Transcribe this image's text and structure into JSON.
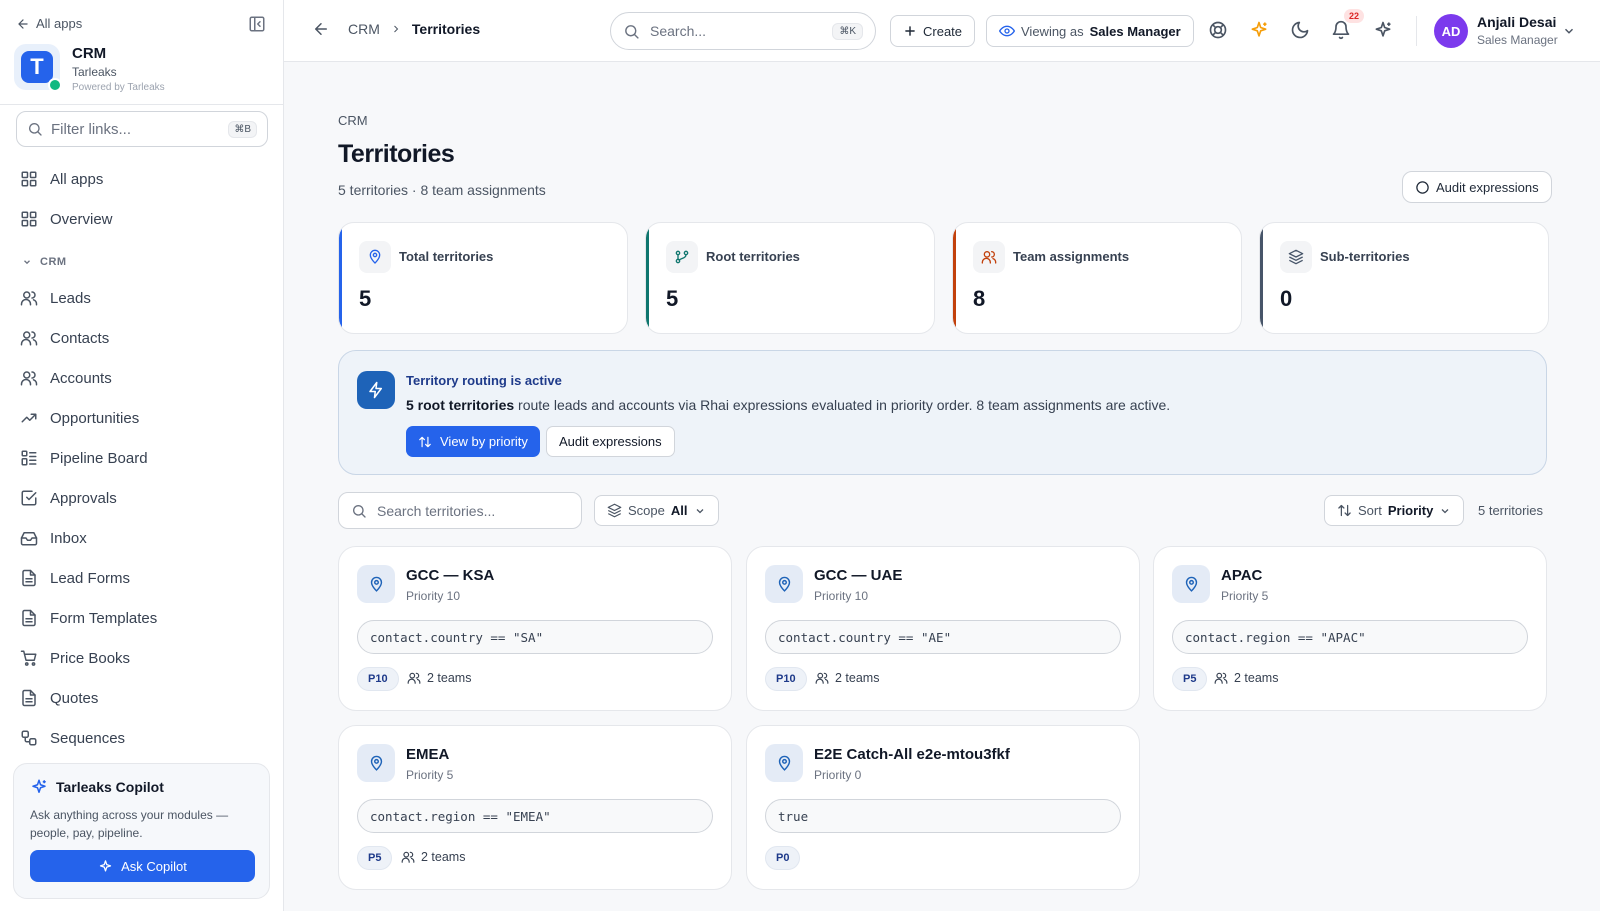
{
  "sidebar": {
    "back_label": "All apps",
    "app_name": "CRM",
    "org_name": "Tarleaks",
    "powered_by": "Powered by Tarleaks",
    "logo_letter": "T",
    "filter_placeholder": "Filter links...",
    "filter_shortcut": "⌘B",
    "top_items": [
      {
        "label": "All apps",
        "icon": "grid-icon"
      },
      {
        "label": "Overview",
        "icon": "grid-icon"
      }
    ],
    "section_label": "CRM",
    "items": [
      {
        "label": "Leads",
        "icon": "users-icon"
      },
      {
        "label": "Contacts",
        "icon": "users-icon"
      },
      {
        "label": "Accounts",
        "icon": "users-icon"
      },
      {
        "label": "Opportunities",
        "icon": "trending-up-icon"
      },
      {
        "label": "Pipeline Board",
        "icon": "kanban-icon"
      },
      {
        "label": "Approvals",
        "icon": "check-square-icon"
      },
      {
        "label": "Inbox",
        "icon": "inbox-icon"
      },
      {
        "label": "Lead Forms",
        "icon": "document-icon"
      },
      {
        "label": "Form Templates",
        "icon": "document-icon"
      },
      {
        "label": "Price Books",
        "icon": "cart-icon"
      },
      {
        "label": "Quotes",
        "icon": "document-icon"
      },
      {
        "label": "Sequences",
        "icon": "workflow-icon"
      }
    ],
    "copilot": {
      "title": "Tarleaks Copilot",
      "description": "Ask anything across your modules — people, pay, pipeline.",
      "button_label": "Ask Copilot"
    }
  },
  "header": {
    "breadcrumb": [
      "CRM",
      "Territories"
    ],
    "search_placeholder": "Search...",
    "search_shortcut": "⌘K",
    "create_label": "Create",
    "viewing_prefix": "Viewing as",
    "viewing_role": "Sales Manager",
    "notification_count": "22",
    "user": {
      "initials": "AD",
      "name": "Anjali Desai",
      "role": "Sales Manager"
    }
  },
  "page": {
    "pre_title": "CRM",
    "title": "Territories",
    "subtitle": "5 territories · 8 team assignments",
    "audit_button": "Audit expressions"
  },
  "stats": [
    {
      "label": "Total territories",
      "value": "5",
      "accent": "#2563eb",
      "icon": "map-pin-icon"
    },
    {
      "label": "Root territories",
      "value": "5",
      "accent": "#0f766e",
      "icon": "git-branch-icon"
    },
    {
      "label": "Team assignments",
      "value": "8",
      "accent": "#c2410c",
      "icon": "users-icon"
    },
    {
      "label": "Sub-territories",
      "value": "0",
      "accent": "#475569",
      "icon": "layers-icon"
    }
  ],
  "routing": {
    "title": "Territory routing is active",
    "desc_bold": "5 root territories",
    "desc_rest": " route leads and accounts via Rhai expressions evaluated in priority order. 8 team assignments are active.",
    "primary_button": "View by priority",
    "secondary_button": "Audit expressions"
  },
  "toolbar": {
    "search_placeholder": "Search territories...",
    "scope_label": "Scope",
    "scope_value": "All",
    "sort_label": "Sort",
    "sort_value": "Priority",
    "count_label": "5 territories"
  },
  "territories": [
    {
      "name": "GCC — KSA",
      "priority": "Priority 10",
      "expression": "contact.country == \"SA\"",
      "badge": "P10",
      "teams": "2 teams"
    },
    {
      "name": "GCC — UAE",
      "priority": "Priority 10",
      "expression": "contact.country == \"AE\"",
      "badge": "P10",
      "teams": "2 teams"
    },
    {
      "name": "APAC",
      "priority": "Priority 5",
      "expression": "contact.region == \"APAC\"",
      "badge": "P5",
      "teams": "2 teams"
    },
    {
      "name": "EMEA",
      "priority": "Priority 5",
      "expression": "contact.region == \"EMEA\"",
      "badge": "P5",
      "teams": "2 teams"
    },
    {
      "name": "E2E Catch-All e2e-mtou3fkf",
      "priority": "Priority 0",
      "expression": "true",
      "badge": "P0",
      "teams": ""
    }
  ]
}
